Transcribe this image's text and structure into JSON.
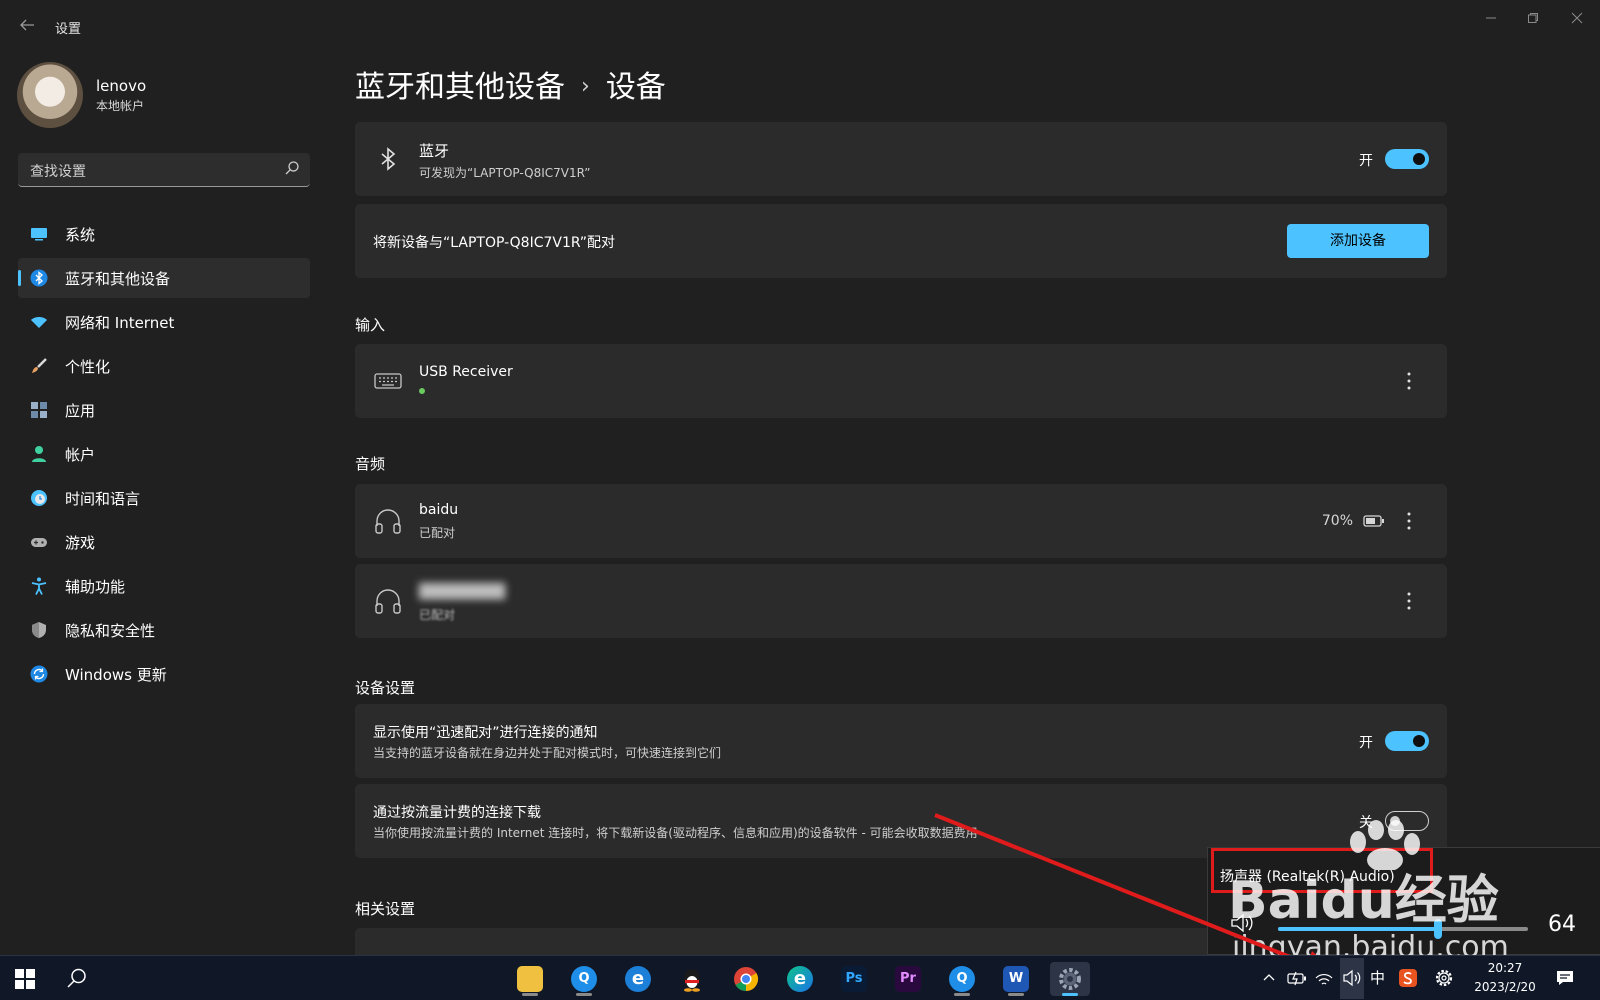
{
  "window": {
    "title": "设置",
    "back_icon": "arrow-left-icon",
    "minimize_icon": "minimize-icon",
    "maximize_icon": "restore-icon",
    "close_icon": "close-icon"
  },
  "user": {
    "name": "lenovo",
    "account_type": "本地帐户"
  },
  "search": {
    "placeholder": "查找设置"
  },
  "sidebar": {
    "items": [
      {
        "label": "系统",
        "icon": "monitor-icon",
        "color": "#4cc2ff"
      },
      {
        "label": "蓝牙和其他设备",
        "icon": "bluetooth-icon",
        "color": "#4cc2ff",
        "active": true
      },
      {
        "label": "网络和 Internet",
        "icon": "wifi-icon",
        "color": "#4cc2ff"
      },
      {
        "label": "个性化",
        "icon": "brush-icon",
        "color": "#e8a060"
      },
      {
        "label": "应用",
        "icon": "apps-icon",
        "color": "#9ab0c8"
      },
      {
        "label": "帐户",
        "icon": "person-icon",
        "color": "#3fd0a0"
      },
      {
        "label": "时间和语言",
        "icon": "globe-clock-icon",
        "color": "#4cc2ff"
      },
      {
        "label": "游戏",
        "icon": "gamepad-icon",
        "color": "#b0b0b0"
      },
      {
        "label": "辅助功能",
        "icon": "accessibility-icon",
        "color": "#4cc2ff"
      },
      {
        "label": "隐私和安全性",
        "icon": "shield-icon",
        "color": "#b0b0b0"
      },
      {
        "label": "Windows 更新",
        "icon": "update-icon",
        "color": "#4cc2ff"
      }
    ]
  },
  "breadcrumb": {
    "parent": "蓝牙和其他设备",
    "separator": "›",
    "current": "设备"
  },
  "bluetooth": {
    "title": "蓝牙",
    "subtitle": "可发现为“LAPTOP-Q8IC7V1R”",
    "toggle_label": "开",
    "toggle_on": true
  },
  "pair": {
    "text": "将新设备与“LAPTOP-Q8IC7V1R”配对",
    "button_label": "添加设备"
  },
  "sections": {
    "input": "输入",
    "audio": "音频",
    "device_settings": "设备设置",
    "related": "相关设置"
  },
  "input_devices": [
    {
      "name": "USB Receiver",
      "icon": "keyboard-icon",
      "connected": true
    }
  ],
  "audio_devices": [
    {
      "name": "baidu",
      "status": "已配对",
      "battery": "70%",
      "icon": "headphones-icon"
    },
    {
      "name": "████████",
      "status": "已配对",
      "icon": "headphones-icon",
      "blurred": true
    }
  ],
  "device_settings": [
    {
      "title": "显示使用“迅速配对”进行连接的通知",
      "subtitle": "当支持的蓝牙设备就在身边并处于配对模式时，可快速连接到它们",
      "toggle_label": "开",
      "toggle_on": true
    },
    {
      "title": "通过按流量计费的连接下载",
      "subtitle": "当你使用按流量计费的 Internet 连接时，将下载新设备(驱动程序、信息和应用)的设备软件 - 可能会收取数据费用",
      "toggle_label": "关",
      "toggle_on": false
    }
  ],
  "volume_flyout": {
    "device": "扬声器 (Realtek(R) Audio)",
    "volume": 64,
    "icon": "speaker-icon",
    "highlight_color": "#e01b1b"
  },
  "watermark": {
    "brand": "Baidu经验",
    "url": "jingyan.baidu.com"
  },
  "taskbar": {
    "apps": [
      {
        "name": "file-explorer",
        "glyph": "",
        "color": "#f0c040"
      },
      {
        "name": "qq-browser",
        "glyph": "Q",
        "color": "#1e8ee8"
      },
      {
        "name": "ie-browser",
        "glyph": "e",
        "color": "#1c7fd8"
      },
      {
        "name": "qq",
        "glyph": "",
        "color": "#222222"
      },
      {
        "name": "chrome",
        "glyph": "",
        "color": "#db4437"
      },
      {
        "name": "edge",
        "glyph": "e",
        "color": "#1aa0d8"
      },
      {
        "name": "photoshop",
        "glyph": "Ps",
        "color": "#0a1b36"
      },
      {
        "name": "premiere",
        "glyph": "Pr",
        "color": "#2a0a3e"
      },
      {
        "name": "qq-browser-2",
        "glyph": "Q",
        "color": "#1e8ee8"
      },
      {
        "name": "word",
        "glyph": "W",
        "color": "#1f57b5"
      },
      {
        "name": "settings",
        "glyph": "",
        "color": "#4a5568"
      }
    ],
    "ime": "中",
    "time": "20:27",
    "date": "2023/2/20"
  }
}
